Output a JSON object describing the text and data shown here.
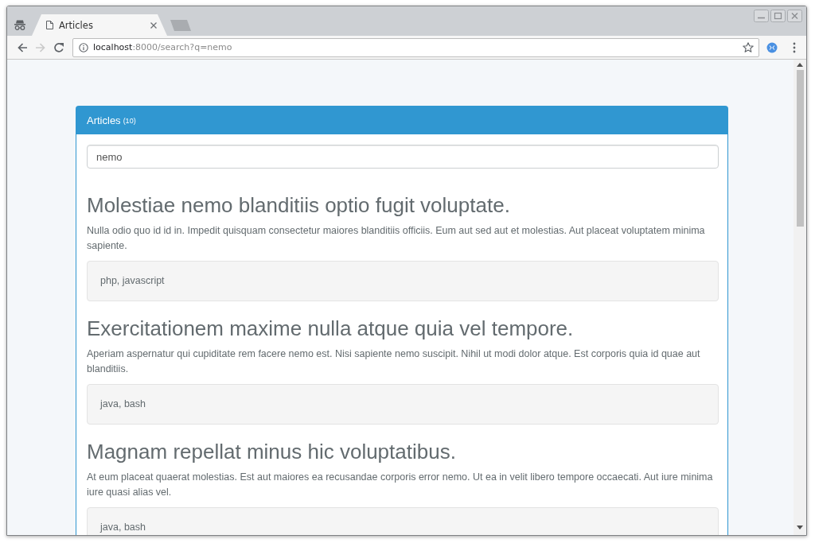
{
  "browser": {
    "tabs": [
      {
        "title": "Articles",
        "selected": true
      }
    ],
    "nav_buttons": [
      {
        "kind": "back",
        "disabled": false
      },
      {
        "kind": "forward",
        "disabled": true
      },
      {
        "kind": "reload",
        "disabled": false
      }
    ],
    "address": {
      "host": "localhost",
      "path": ":8000/search?q=nemo"
    }
  },
  "panel": {
    "title": "Articles",
    "count": "(10)"
  },
  "search": {
    "value": "nemo"
  },
  "articles": [
    {
      "title": "Molestiae nemo blanditiis optio fugit voluptate.",
      "body": "Nulla odio quo id id in. Impedit quisquam consectetur maiores blanditiis officiis. Eum aut sed aut et molestias. Aut placeat voluptatem minima sapiente.",
      "tags": "php, javascript"
    },
    {
      "title": "Exercitationem maxime nulla atque quia vel tempore.",
      "body": "Aperiam aspernatur qui cupiditate rem facere nemo est. Nisi sapiente nemo suscipit. Nihil ut modi dolor atque. Est corporis quia id quae aut blanditiis.",
      "tags": "java, bash"
    },
    {
      "title": "Magnam repellat minus hic voluptatibus.",
      "body": "At eum placeat quaerat molestias. Est aut maiores ea recusandae corporis error nemo. Ut ea in velit libero tempore occaecati. Aut iure minima iure quasi alias vel.",
      "tags": "java, bash"
    }
  ]
}
